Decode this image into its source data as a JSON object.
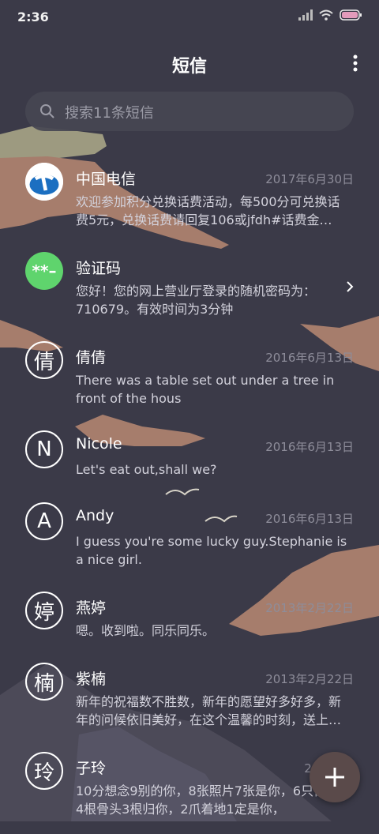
{
  "status_bar": {
    "time": "2:36"
  },
  "header": {
    "title": "短信"
  },
  "search": {
    "placeholder": "搜索11条短信"
  },
  "messages": [
    {
      "name": "中国电信",
      "date": "2017年6月30日",
      "preview": "欢迎参加积分兑换话费活动，每500分可兑换话费5元，兑换话费请回复106或jfdh#话费金…",
      "avatar": "telecom-logo"
    },
    {
      "name": "验证码",
      "date": "",
      "preview": "您好！您的网上营业厅登录的随机密码为：710679。有效时间为3分钟",
      "avatar_text": "**–"
    },
    {
      "name": "倩倩",
      "date": "2016年6月13日",
      "preview": "There was a table set out under a tree in front of the hous",
      "avatar_text": "倩"
    },
    {
      "name": "Nicole",
      "date": "2016年6月13日",
      "preview": "Let's eat out,shall we?",
      "avatar_text": "N"
    },
    {
      "name": "Andy",
      "date": "2016年6月13日",
      "preview": "I guess you're some lucky guy.Stephanie is a nice girl.",
      "avatar_text": "A"
    },
    {
      "name": "燕婷",
      "date": "2013年2月22日",
      "preview": "嗯。收到啦。同乐同乐。",
      "avatar_text": "婷"
    },
    {
      "name": "紫楠",
      "date": "2013年2月22日",
      "preview": "新年的祝福数不胜数，新年的愿望好多好多，新年的问候依旧美好，在这个温馨的时刻，送上…",
      "avatar_text": "楠"
    },
    {
      "name": "子玲",
      "date": "2013年2",
      "preview": "10分想念9别的你，8张照片7张是你，6只像你，4根骨头3根归你，2爪着地1定是你，",
      "avatar_text": "玲"
    }
  ],
  "colors": {
    "background": "#3b3a48",
    "avatar_green": "#5fd46d",
    "fab": "#5a4a4a",
    "accent_rock": "#a67d6c"
  },
  "icons": {
    "more": "more-vert-icon",
    "search": "search-icon",
    "chevron": "chevron-right-icon",
    "fab": "plus-icon"
  }
}
